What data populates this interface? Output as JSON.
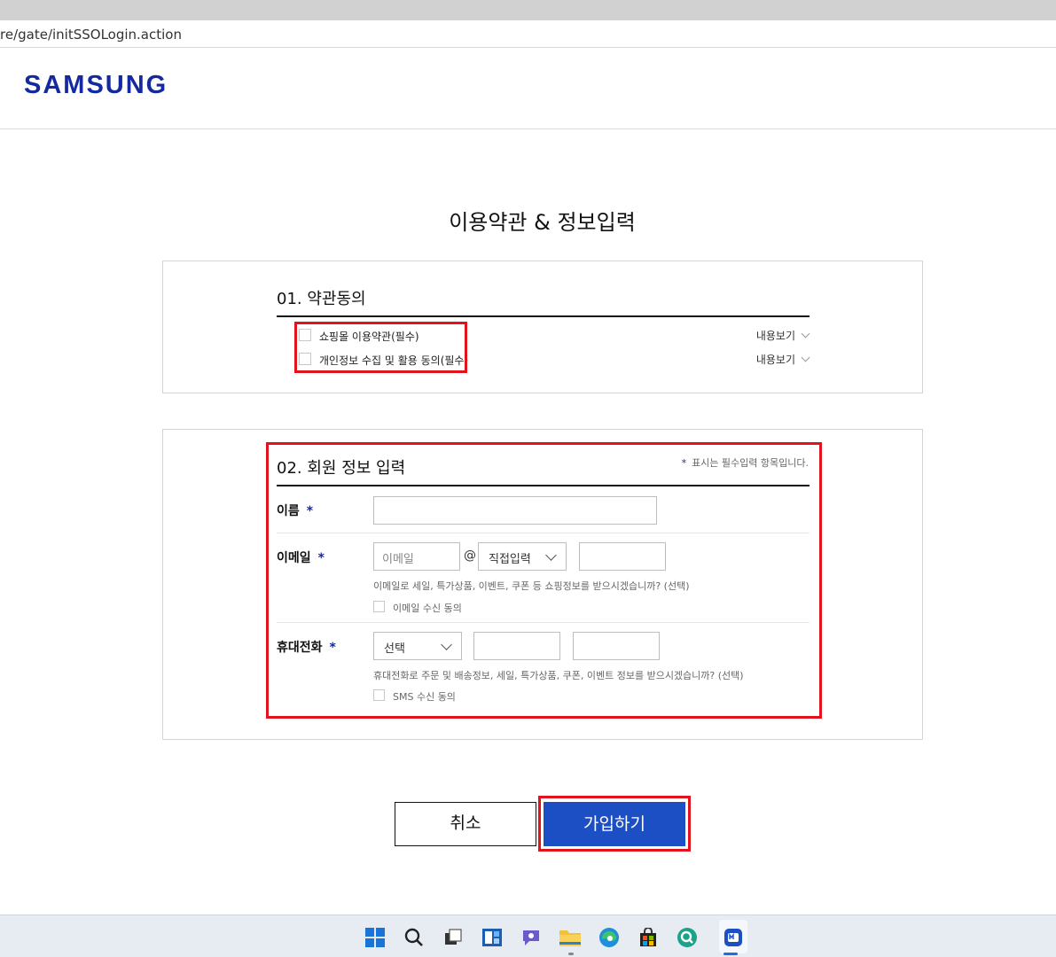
{
  "browser": {
    "url": "re/gate/initSSOLogin.action"
  },
  "header": {
    "logo_text": "SAMSUNG"
  },
  "page": {
    "title": "이용약관 & 정보입력"
  },
  "terms": {
    "section_title": "01. 약관동의",
    "items": [
      {
        "label": "쇼핑몰 이용약관(필수)",
        "checked": false,
        "view_label": "내용보기"
      },
      {
        "label": "개인정보 수집 및 활용 동의(필수)",
        "checked": false,
        "view_label": "내용보기"
      }
    ]
  },
  "member_info": {
    "section_title": "02. 회원 정보 입력",
    "required_mark": "*",
    "required_note": "표시는 필수입력 항목입니다.",
    "name": {
      "label": "이름",
      "value": ""
    },
    "email": {
      "label": "이메일",
      "id_placeholder": "이메일",
      "at_sign": "@",
      "domain_select": "직접입력",
      "domain_value": "",
      "hint": "이메일로 세일, 특가상품, 이벤트, 쿠폰 등 쇼핑정보를 받으시겠습니까? (선택)",
      "agree_label": "이메일 수신 동의",
      "agree_checked": false
    },
    "phone": {
      "label": "휴대전화",
      "prefix_select": "선택",
      "middle_value": "",
      "last_value": "",
      "hint": "휴대전화로 주문 및 배송정보, 세일, 특가상품, 쿠폰, 이벤트 정보를 받으시겠습니까? (선택)",
      "agree_label": "SMS 수신 동의",
      "agree_checked": false
    }
  },
  "actions": {
    "cancel_label": "취소",
    "join_label": "가입하기"
  },
  "colors": {
    "brand": "#1428a0",
    "primary_button": "#1d4fc4",
    "highlight": "#e3131d"
  },
  "taskbar": {
    "icons": [
      "windows-start-icon",
      "search-icon",
      "task-view-icon",
      "widgets-icon",
      "chat-icon",
      "file-explorer-icon",
      "edge-icon",
      "store-icon",
      "app-icon",
      "active-app-icon"
    ]
  }
}
